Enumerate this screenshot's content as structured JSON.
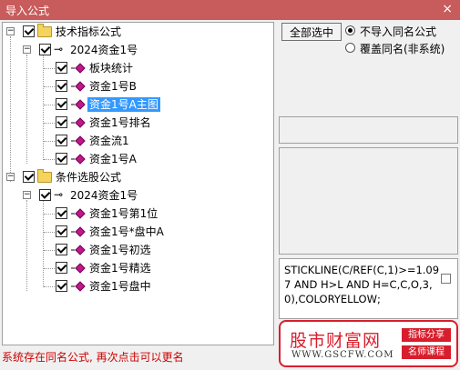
{
  "window": {
    "title": "导入公式",
    "close_glyph": "×"
  },
  "tree": {
    "groups": [
      {
        "label": "技术指标公式",
        "child": {
          "label": "2024资金1号",
          "items": [
            "板块统计",
            "资金1号B",
            "资金1号A主图",
            "资金1号排名",
            "资金流1",
            "资金1号A"
          ],
          "selected": "资金1号A主图"
        }
      },
      {
        "label": "条件选股公式",
        "child": {
          "label": "2024资金1号",
          "items": [
            "资金1号第1位",
            "资金1号*盘中A",
            "资金1号初选",
            "资金1号精选",
            "资金1号盘中"
          ]
        }
      }
    ]
  },
  "options": {
    "select_all_label": "全部选中",
    "radio1": "不导入同名公式",
    "radio2": "覆盖同名(非系统)",
    "radio_selected": "radio1"
  },
  "code": {
    "text": "STICKLINE(C/REF(C,1)>=1.097 AND H>L AND H=C,C,O,3,0),COLORYELLOW;"
  },
  "watermark": {
    "name": "股市财富网",
    "url": "WWW.GSCFW.COM",
    "tag1": "指标分享",
    "tag2": "名师课程"
  },
  "status": {
    "message": "系统存在同名公式, 再次点击可以更名"
  },
  "colors": {
    "titlebar": "#c85b5b",
    "selection": "#3399ff",
    "status_text": "#d00000",
    "brand_red": "#d81e2c"
  }
}
